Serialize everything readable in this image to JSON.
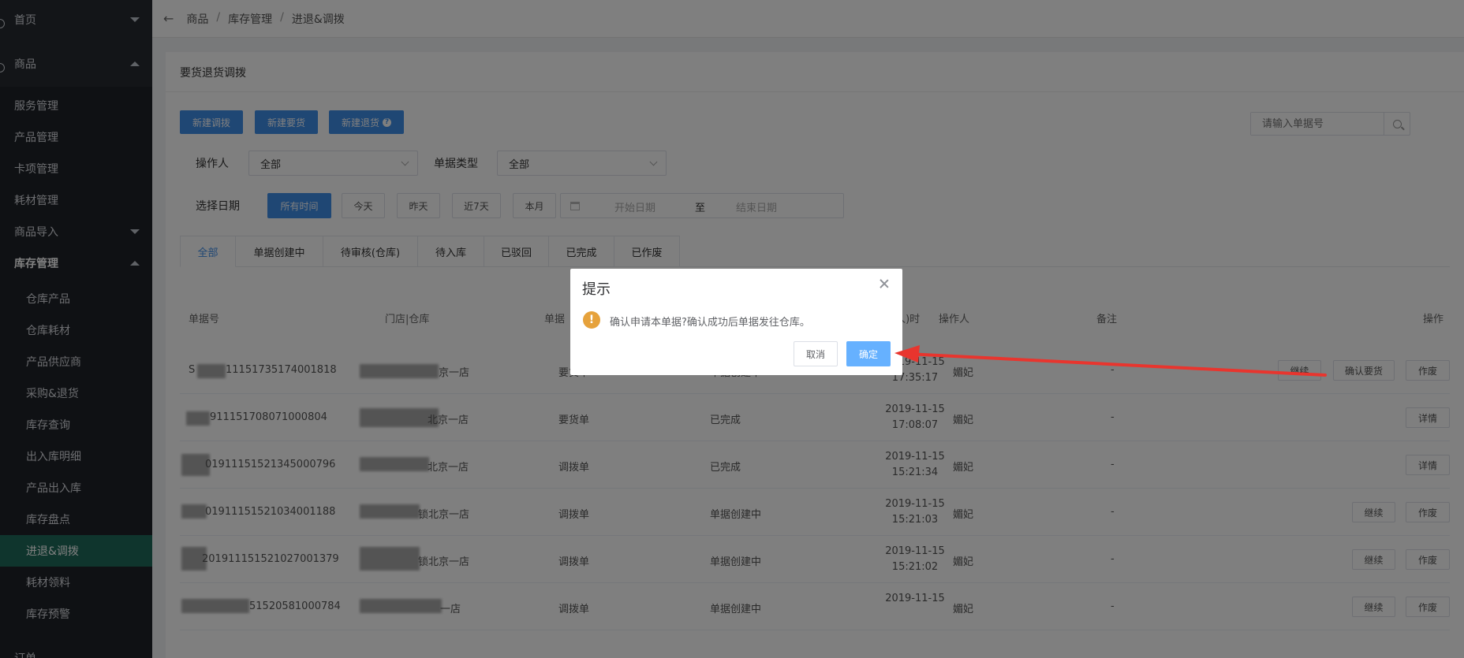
{
  "sidebar": {
    "top_items": [
      {
        "label": "首页"
      },
      {
        "label": "商品"
      }
    ],
    "items": [
      {
        "label": "服务管理"
      },
      {
        "label": "产品管理"
      },
      {
        "label": "卡项管理"
      },
      {
        "label": "耗材管理"
      },
      {
        "label": "商品导入"
      },
      {
        "label": "库存管理"
      }
    ],
    "sub_items": [
      {
        "label": "仓库产品"
      },
      {
        "label": "仓库耗材"
      },
      {
        "label": "产品供应商"
      },
      {
        "label": "采购&退货"
      },
      {
        "label": "库存查询"
      },
      {
        "label": "出入库明细"
      },
      {
        "label": "产品出入库"
      },
      {
        "label": "库存盘点"
      },
      {
        "label": "进退&调拨"
      },
      {
        "label": "耗材领料"
      },
      {
        "label": "库存预警"
      }
    ],
    "bottom_partial": "订单"
  },
  "header": {
    "breadcrumb": [
      "商品",
      "库存管理",
      "进退&调拨"
    ],
    "separator": "/"
  },
  "card": {
    "title": "要货退货调拨",
    "buttons": {
      "new_transfer": "新建调拨",
      "new_request": "新建要货",
      "new_return": "新建退货",
      "info_mark": "?"
    },
    "search": {
      "placeholder": "请输入单据号"
    },
    "filters": {
      "operator_label": "操作人",
      "operator_value": "全部",
      "type_label": "单据类型",
      "type_value": "全部",
      "date_label": "选择日期",
      "date_buttons": [
        "所有时间",
        "今天",
        "昨天",
        "近7天",
        "本月"
      ],
      "start_placeholder": "开始日期",
      "to": "至",
      "end_placeholder": "结束日期"
    },
    "tabs": [
      "全部",
      "单据创建中",
      "待审核(仓库)",
      "待入库",
      "已驳回",
      "已完成",
      "已作废"
    ],
    "table": {
      "headers": {
        "no": "单据号",
        "store": "门店|仓库",
        "type": "单据",
        "time": "(人)时",
        "operator": "操作人",
        "remark": "备注",
        "action": "操作"
      },
      "rows": [
        {
          "no": "11151735174001818",
          "prefix": "S",
          "store": "京一店",
          "type": "要货单",
          "status": "单据创建中",
          "date": "2019-11-15",
          "time": "17:35:17",
          "operator": "媚妃",
          "remark": "-",
          "actions": [
            "继续",
            "确认要货",
            "作废"
          ]
        },
        {
          "no": "911151708071000804",
          "prefix": "",
          "store": "北京一店",
          "type": "要货单",
          "status": "已完成",
          "date": "2019-11-15",
          "time": "17:08:07",
          "operator": "媚妃",
          "remark": "-",
          "actions": [
            "详情"
          ]
        },
        {
          "no": "01911151521345000796",
          "prefix": "",
          "store": "北京一店",
          "type": "调拨单",
          "status": "已完成",
          "date": "2019-11-15",
          "time": "15:21:34",
          "operator": "媚妃",
          "remark": "-",
          "actions": [
            "详情"
          ]
        },
        {
          "no": "01911151521034001188",
          "prefix": "",
          "store": "锁北京一店",
          "type": "调拨单",
          "status": "单据创建中",
          "date": "2019-11-15",
          "time": "15:21:03",
          "operator": "媚妃",
          "remark": "-",
          "actions": [
            "继续",
            "作废"
          ]
        },
        {
          "no": "201911151521027001379",
          "prefix": "",
          "store": "锁北京一店",
          "type": "调拨单",
          "status": "单据创建中",
          "date": "2019-11-15",
          "time": "15:21:02",
          "operator": "媚妃",
          "remark": "-",
          "actions": [
            "继续",
            "作废"
          ]
        },
        {
          "no": "51520581000784",
          "prefix": "",
          "store": "一店",
          "type": "调拨单",
          "status": "单据创建中",
          "date": "2019-11-15",
          "time": "",
          "operator": "媚妃",
          "remark": "-",
          "actions": [
            "继续",
            "作废"
          ]
        }
      ]
    }
  },
  "dialog": {
    "title": "提示",
    "message": "确认申请本单据?确认成功后单据发往仓库。",
    "warn_mark": "!",
    "cancel": "取消",
    "ok": "确定"
  },
  "colors": {
    "primary": "#3f8ee8",
    "sidebar_bg": "#1f2329",
    "sidebar_active": "#1f6b5b",
    "warning": "#e6a23c",
    "annotation_arrow": "#e8352e"
  }
}
